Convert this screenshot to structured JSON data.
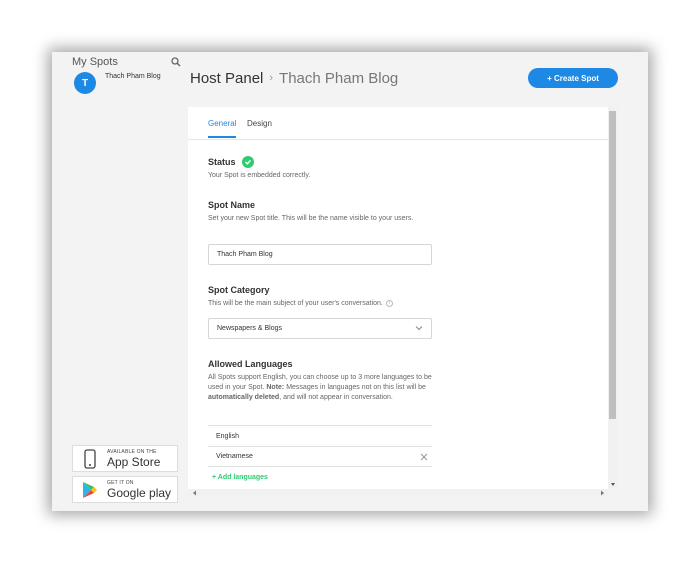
{
  "sidebar": {
    "title": "My Spots",
    "spot": {
      "name": "Thach Pham Blog",
      "logo_letter": "T"
    },
    "app_store": {
      "small": "AVAILABLE ON THE",
      "big": "App Store"
    },
    "google_play": {
      "small": "GET IT ON",
      "big": "Google play"
    }
  },
  "header": {
    "title": "Host Panel",
    "separator": "›",
    "spot_name": "Thach Pham Blog",
    "create_button": "+ Create Spot"
  },
  "tabs": [
    {
      "label": "General",
      "active": true
    },
    {
      "label": "Design",
      "active": false
    }
  ],
  "status": {
    "title": "Status",
    "description": "Your Spot is embedded correctly."
  },
  "spot_name": {
    "title": "Spot Name",
    "description": "Set your new Spot title. This will be the name visible to your users.",
    "value": "Thach Pham Blog"
  },
  "spot_category": {
    "title": "Spot Category",
    "description": "This will be the main subject of your user's conversation.",
    "selected": "Newspapers & Blogs"
  },
  "languages": {
    "title": "Allowed Languages",
    "desc_part1": "All Spots support English, you can choose up to 3 more languages to be used in your Spot. ",
    "desc_note": "Note:",
    "desc_part2": " Messages in languages not on this list will be ",
    "desc_bold": "automatically deleted",
    "desc_part3": ", and will not appear in conversation.",
    "items": [
      "English",
      "Vietnamese"
    ],
    "add_label": "+ Add languages"
  },
  "colors": {
    "accent": "#1e88e5",
    "success": "#2ecc71"
  }
}
